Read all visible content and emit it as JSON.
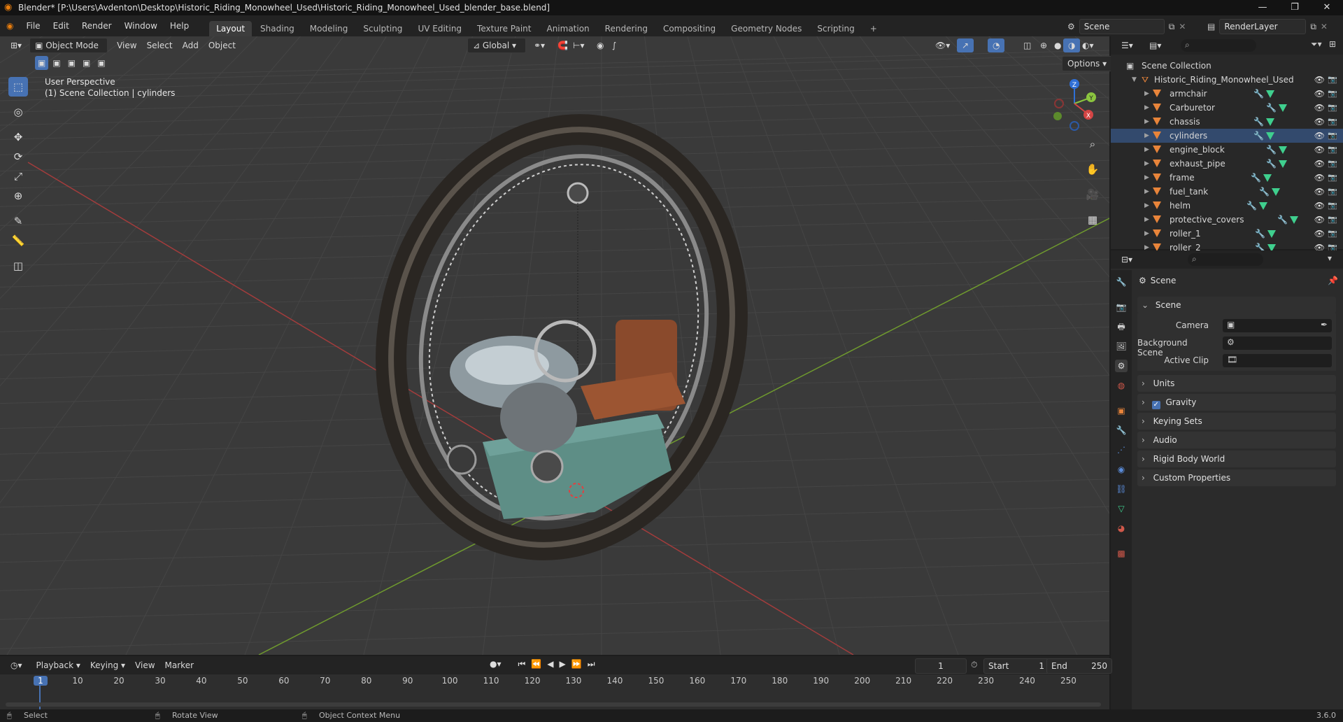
{
  "window": {
    "title": "Blender* [P:\\Users\\Avdenton\\Desktop\\Historic_Riding_Monowheel_Used\\Historic_Riding_Monowheel_Used_blender_base.blend]",
    "minimize": "—",
    "maximize": "❐",
    "close": "✕"
  },
  "menu": [
    "File",
    "Edit",
    "Render",
    "Window",
    "Help"
  ],
  "workspaces": [
    "Layout",
    "Shading",
    "Modeling",
    "Sculpting",
    "UV Editing",
    "Texture Paint",
    "Animation",
    "Rendering",
    "Compositing",
    "Geometry Nodes",
    "Scripting",
    "+"
  ],
  "active_workspace": "Layout",
  "scene_selector": "Scene",
  "view_layer": "RenderLayer",
  "viewport": {
    "mode": "Object Mode",
    "menus": [
      "View",
      "Select",
      "Add",
      "Object"
    ],
    "orientation": "Global",
    "options": "Options",
    "overlay_line1": "User Perspective",
    "overlay_line2": "(1) Scene Collection | cylinders",
    "gizmo": {
      "x": "X",
      "y": "Y",
      "z": "Z"
    },
    "colors": {
      "grid_bg": "#3a3a3a",
      "x_axis": "#d44545",
      "y_axis": "#8bc53f",
      "accent": "#4772b3"
    }
  },
  "outliner": {
    "root": "Scene Collection",
    "collection": "Historic_Riding_Monowheel_Used",
    "objects": [
      "armchair",
      "Carburetor",
      "chassis",
      "cylinders",
      "engine_block",
      "exhaust_pipe",
      "frame",
      "fuel_tank",
      "helm",
      "protective_covers",
      "roller_1",
      "roller_2"
    ],
    "selected": "cylinders"
  },
  "properties": {
    "context": "Scene",
    "panel_scene": "Scene",
    "camera_label": "Camera",
    "background_scene_label": "Background Scene",
    "active_clip_label": "Active Clip",
    "sections": [
      "Units",
      "Gravity",
      "Keying Sets",
      "Audio",
      "Rigid Body World",
      "Custom Properties"
    ],
    "gravity_checked": true
  },
  "timeline": {
    "menus": [
      "Playback",
      "Keying",
      "View",
      "Marker"
    ],
    "current_frame": "1",
    "start_label": "Start",
    "start": "1",
    "end_label": "End",
    "end": "250",
    "ruler": [
      "1",
      "10",
      "20",
      "30",
      "40",
      "50",
      "60",
      "70",
      "80",
      "90",
      "100",
      "110",
      "120",
      "130",
      "140",
      "150",
      "160",
      "170",
      "180",
      "190",
      "200",
      "210",
      "220",
      "230",
      "240",
      "250"
    ]
  },
  "statusbar": {
    "select": "Select",
    "rotate": "Rotate View",
    "context_menu": "Object Context Menu",
    "version": "3.6.0"
  }
}
